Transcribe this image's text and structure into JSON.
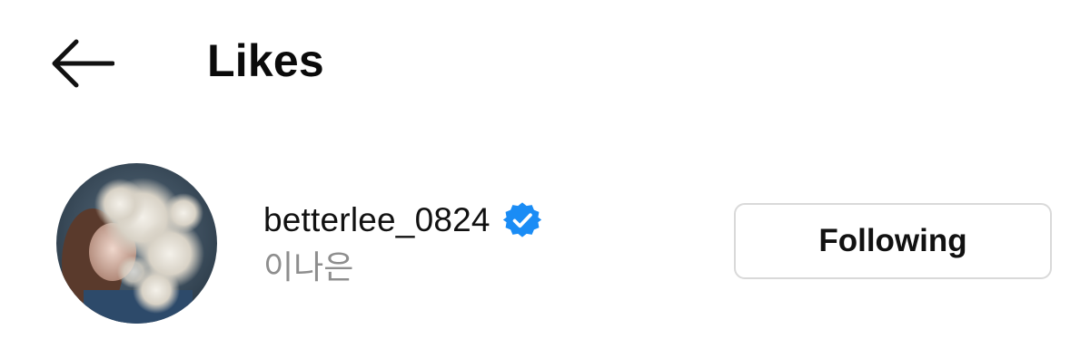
{
  "header": {
    "back_icon": "arrow-left-icon",
    "title": "Likes"
  },
  "user": {
    "username": "betterlee_0824",
    "verified": true,
    "verified_icon": "verified-badge-icon",
    "verified_color": "#1a8cf5",
    "full_name": "이나은",
    "follow_state_label": "Following"
  },
  "colors": {
    "background": "#ffffff",
    "primary_text": "#111111",
    "secondary_text": "#8e8e8e",
    "button_border": "#d9d9d9"
  }
}
